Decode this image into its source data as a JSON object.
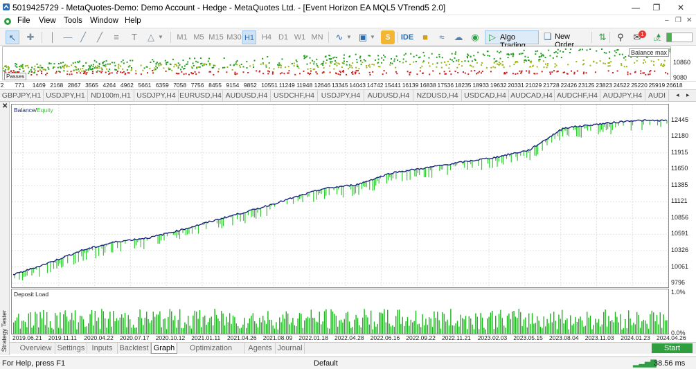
{
  "window": {
    "title": "5019425729 - MetaQuotes-Demo: Demo Account - Hedge - MetaQuotes Ltd. - [Event Horizon EA MQL5 VTrend5 2.0]"
  },
  "menu": {
    "items": [
      "File",
      "View",
      "Tools",
      "Window",
      "Help"
    ]
  },
  "toolbar": {
    "timeframes": [
      "M1",
      "M5",
      "M15",
      "M30",
      "H1",
      "H4",
      "D1",
      "W1",
      "MN"
    ],
    "active_timeframe": "H1",
    "ide_label": "IDE",
    "algo_trading_label": "Algo Trading",
    "new_order_label": "New Order",
    "notification_count": "1",
    "lvl_label": "LVL"
  },
  "optimization": {
    "balance_max_label": "Balance max",
    "passes_label": "Passes",
    "y_ticks": [
      "10860",
      "9080"
    ],
    "x_ticks": [
      "72",
      "771",
      "1469",
      "2168",
      "2867",
      "3565",
      "4264",
      "4962",
      "5661",
      "6359",
      "7058",
      "7756",
      "8455",
      "9154",
      "9852",
      "10551",
      "11249",
      "11948",
      "12646",
      "13345",
      "14043",
      "14742",
      "15441",
      "16139",
      "16838",
      "17536",
      "18235",
      "18933",
      "19632",
      "20331",
      "21029",
      "21728",
      "22426",
      "23125",
      "23823",
      "24522",
      "25220",
      "25919",
      "26618"
    ]
  },
  "symbol_tabs": [
    "GBPJPY,H1",
    "USDJPY,H1",
    "ND100m,H1",
    "USDJPY,H4",
    "EURUSD,H4",
    "AUDUSD,H4",
    "USDCHF,H4",
    "USDJPY,H4",
    "AUDUSD,H4",
    "NZDUSD,H4",
    "USDCAD,H4",
    "AUDCAD,H4",
    "AUDCHF,H4",
    "AUDJPY,H4",
    "AUDI"
  ],
  "side_label": "Strategy Tester",
  "chart_data": [
    {
      "type": "line",
      "title": "",
      "legend": [
        "Balance",
        "Equity"
      ],
      "legend_separator": "/",
      "colors": {
        "balance": "#1a237e",
        "equity": "#2ecc2e"
      },
      "ylim": [
        9796,
        12700
      ],
      "y_ticks": [
        "12445",
        "12180",
        "11915",
        "11650",
        "11385",
        "11121",
        "10856",
        "10591",
        "10326",
        "10061",
        "9796"
      ],
      "x_ticks": [
        "2019.06.21",
        "2019.11.11",
        "2020.04.22",
        "2020.07.17",
        "2020.10.12",
        "2021.01.11",
        "2021.04.26",
        "2021.08.09",
        "2022.01.18",
        "2022.04.28",
        "2022.06.16",
        "2022.09.22",
        "2022.11.21",
        "2023.02.03",
        "2023.05.15",
        "2023.08.04",
        "2023.11.03",
        "2024.01.23",
        "2024.04.26"
      ],
      "series": [
        {
          "name": "Balance",
          "x": [
            "2019.06.21",
            "2019.11.11",
            "2020.04.22",
            "2020.07.17",
            "2020.10.12",
            "2021.01.11",
            "2021.04.26",
            "2021.08.09",
            "2022.01.18",
            "2022.04.28",
            "2022.06.16",
            "2022.09.22",
            "2022.11.21",
            "2023.02.03",
            "2023.05.15",
            "2023.08.04",
            "2023.11.03",
            "2024.01.23",
            "2024.04.26",
            "2024.06.20"
          ],
          "values": [
            9930,
            10120,
            10330,
            10470,
            10540,
            10680,
            10840,
            10990,
            11160,
            11330,
            11400,
            11590,
            11670,
            11760,
            11840,
            11960,
            12320,
            12380,
            12440,
            12440
          ]
        }
      ]
    },
    {
      "type": "bar",
      "title": "Deposit Load",
      "y_ticks": [
        "1.0%",
        "0.0%"
      ],
      "ylim": [
        0,
        1.0
      ],
      "color": "#18b818",
      "values_note_free": true
    }
  ],
  "bottom_tabs": [
    "Overview",
    "Settings",
    "Inputs",
    "Backtest",
    "Graph",
    "Optimization Results",
    "Agents",
    "Journal"
  ],
  "active_bottom_tab": "Graph",
  "start_label": "Start",
  "status": {
    "help": "For Help, press F1",
    "profile": "Default",
    "ping": "38.56 ms"
  }
}
